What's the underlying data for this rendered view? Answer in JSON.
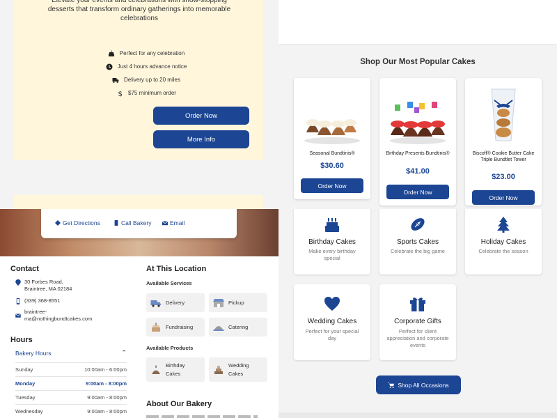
{
  "promo": {
    "description": "Elevate your events and celebrations with show-stopping desserts that transform ordinary gatherings into memorable celebrations",
    "features": [
      {
        "icon": "cake-icon",
        "label": "Perfect for any celebration"
      },
      {
        "icon": "clock-icon",
        "label": "Just 4 hours advance notice"
      },
      {
        "icon": "truck-icon",
        "label": "Delivery up to 20 miles"
      },
      {
        "icon": "dollar-icon",
        "label": "$75 minimum order"
      }
    ],
    "order_now": "Order Now",
    "more_info": "More Info"
  },
  "popular": {
    "title": "Shop Our Most Popular Cakes",
    "items": [
      {
        "name": "Seasonal Bundtinis®",
        "price": "$30.60",
        "button": "Order Now"
      },
      {
        "name": "Birthday Presents Bundtinis®",
        "price": "$41.00",
        "button": "Order Now"
      },
      {
        "name": "Biscoff® Cookie Butter Cake Triple Bundtlet Tower",
        "price": "$23.00",
        "button": "Order Now"
      }
    ]
  },
  "location": {
    "actions": {
      "directions": "Get Directions",
      "call": "Call Bakery",
      "email": "Email"
    },
    "contact_title": "Contact",
    "address_line1": "30 Forbes Road,",
    "address_line2": "Braintree, MA 02184",
    "phone": "(339) 368-8551",
    "email_line1": "braintree-",
    "email_line2": "ma@nothingbundtcakes.com",
    "hours_title": "Hours",
    "hours_toggle": "Bakery Hours",
    "hours": [
      {
        "day": "Sunday",
        "time": "10:00am - 6:00pm"
      },
      {
        "day": "Monday",
        "time": "9:00am - 8:00pm"
      },
      {
        "day": "Tuesday",
        "time": "9:00am - 8:00pm"
      },
      {
        "day": "Wednesday",
        "time": "9:00am - 8:00pm"
      }
    ],
    "at_location_title": "At This Location",
    "services_label": "Available Services",
    "services": [
      "Delivery",
      "Pickup",
      "Fundraising",
      "Catering"
    ],
    "products_label": "Available Products",
    "products": [
      {
        "line1": "Birthday",
        "line2": "Cakes"
      },
      {
        "line1": "Wedding",
        "line2": "Cakes"
      }
    ],
    "about_title": "About Our Bakery"
  },
  "occasions": {
    "items": [
      {
        "title": "Birthday Cakes",
        "desc": "Make every birthday special"
      },
      {
        "title": "Sports Cakes",
        "desc": "Celebrate the big game"
      },
      {
        "title": "Holiday Cakes",
        "desc": "Celebrate the season"
      },
      {
        "title": "Wedding Cakes",
        "desc": "Perfect for your special day"
      },
      {
        "title": "Corporate Gifts",
        "desc": "Perfect for client appreciation and corporate events"
      }
    ],
    "shop_all": "Shop All Occasions"
  },
  "colors": {
    "brand_blue": "#1c4593",
    "promo_bg": "#fff6dc"
  }
}
